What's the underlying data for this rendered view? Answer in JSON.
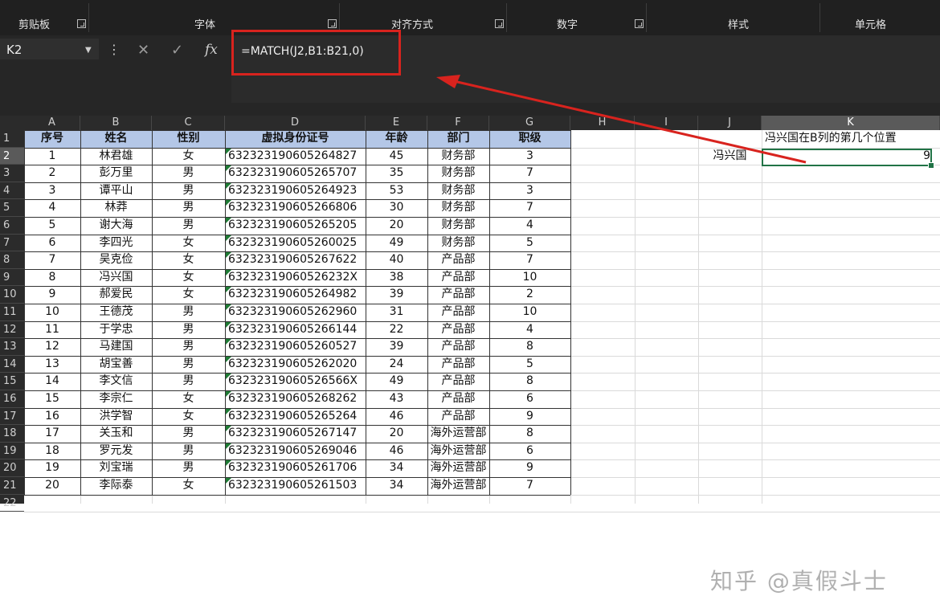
{
  "ribbon": {
    "groups": [
      {
        "label": "剪贴板"
      },
      {
        "label": "字体"
      },
      {
        "label": "对齐方式"
      },
      {
        "label": "数字"
      },
      {
        "label": "样式"
      },
      {
        "label": "单元格"
      }
    ]
  },
  "formula_bar": {
    "name_box": "K2",
    "cancel_symbol": "✕",
    "enter_symbol": "✓",
    "fx_label": "fx",
    "formula": "=MATCH(J2,B1:B21,0)"
  },
  "columns": [
    "A",
    "B",
    "C",
    "D",
    "E",
    "F",
    "G",
    "H",
    "I",
    "J",
    "K"
  ],
  "rows": [
    "1",
    "2",
    "3",
    "4",
    "5",
    "6",
    "7",
    "8",
    "9",
    "10",
    "11",
    "12",
    "13",
    "14",
    "15",
    "16",
    "17",
    "18",
    "19",
    "20",
    "21",
    "22"
  ],
  "table": {
    "headers": [
      "序号",
      "姓名",
      "性别",
      "虚拟身份证号",
      "年龄",
      "部门",
      "职级"
    ],
    "data": [
      [
        "1",
        "林君雄",
        "女",
        "632323190605264827",
        "45",
        "财务部",
        "3"
      ],
      [
        "2",
        "彭万里",
        "男",
        "632323190605265707",
        "35",
        "财务部",
        "7"
      ],
      [
        "3",
        "谭平山",
        "男",
        "632323190605264923",
        "53",
        "财务部",
        "3"
      ],
      [
        "4",
        "林莽",
        "男",
        "632323190605266806",
        "30",
        "财务部",
        "7"
      ],
      [
        "5",
        "谢大海",
        "男",
        "632323190605265205",
        "20",
        "财务部",
        "4"
      ],
      [
        "6",
        "李四光",
        "女",
        "632323190605260025",
        "49",
        "财务部",
        "5"
      ],
      [
        "7",
        "吴克俭",
        "女",
        "632323190605267622",
        "40",
        "产品部",
        "7"
      ],
      [
        "8",
        "冯兴国",
        "女",
        "63232319060526232X",
        "38",
        "产品部",
        "10"
      ],
      [
        "9",
        "郝爱民",
        "女",
        "632323190605264982",
        "39",
        "产品部",
        "2"
      ],
      [
        "10",
        "王德茂",
        "男",
        "632323190605262960",
        "31",
        "产品部",
        "10"
      ],
      [
        "11",
        "于学忠",
        "男",
        "632323190605266144",
        "22",
        "产品部",
        "4"
      ],
      [
        "12",
        "马建国",
        "男",
        "632323190605260527",
        "39",
        "产品部",
        "8"
      ],
      [
        "13",
        "胡宝善",
        "男",
        "632323190605262020",
        "24",
        "产品部",
        "5"
      ],
      [
        "14",
        "李文信",
        "男",
        "63232319060526566X",
        "49",
        "产品部",
        "8"
      ],
      [
        "15",
        "李宗仁",
        "女",
        "632323190605268262",
        "43",
        "产品部",
        "6"
      ],
      [
        "16",
        "洪学智",
        "女",
        "632323190605265264",
        "46",
        "产品部",
        "9"
      ],
      [
        "17",
        "关玉和",
        "男",
        "632323190605267147",
        "20",
        "海外运营部",
        "8"
      ],
      [
        "18",
        "罗元发",
        "男",
        "632323190605269046",
        "46",
        "海外运营部",
        "6"
      ],
      [
        "19",
        "刘宝瑞",
        "男",
        "632323190605261706",
        "34",
        "海外运营部",
        "9"
      ],
      [
        "20",
        "李际泰",
        "女",
        "632323190605261503",
        "34",
        "海外运营部",
        "7"
      ]
    ]
  },
  "lookup": {
    "k1_label": "冯兴国在B列的第几个位置",
    "j2_value": "冯兴国",
    "k2_result": "9"
  },
  "watermark": "知乎 @真假斗士",
  "colors": {
    "header_fill": "#b4c7e7",
    "annotation_red": "#d8231e",
    "selection_green": "#217346"
  }
}
